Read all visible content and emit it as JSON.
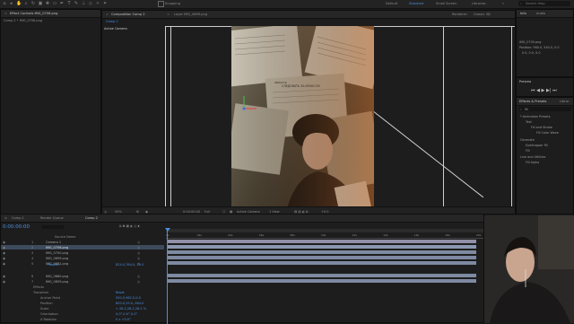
{
  "workspaces": [
    "Default",
    "Standard",
    "Small Screen",
    "Libraries"
  ],
  "toolbar": {
    "snapping_label": "Snapping",
    "search_placeholder": "Search Help"
  },
  "effect_controls": {
    "tab_label": "Effect Controls  IMG_0706.png",
    "breadcrumb": "Comp 2 • IMG_0706.png"
  },
  "viewer": {
    "composition_tab": "Composition  Comp 2",
    "layer_tab": "Layer  IMG_0699.png",
    "comp_breadcrumb": "Comp 2",
    "camera_label": "Active Camera",
    "renderer_label": "Renderer:",
    "renderer_value": "Classic 3D",
    "zoom": "50%",
    "resolution": "Full",
    "view_camera": "Active Camera",
    "view_count": "1 View",
    "exposure": "+0.0",
    "newspaper_headline": "СЛЕДОВАТЬ ЗА ИРАКСОМ",
    "newspaper_subheadline": "ОБЛАСТЬ"
  },
  "info_panel": {
    "tab_info": "Info",
    "tab_audio": "Audio",
    "file": "IMG_0709.png",
    "position": "Position: 960.0, 540.0, 0.0",
    "values": "0.0,  0.0,  0.0"
  },
  "preview_panel": {
    "title": "Preview"
  },
  "effects_presets": {
    "tab_label": "Effects & Presets",
    "tab_library": "Librar",
    "search_value": "fill",
    "items": [
      {
        "label": "* Animation Presets",
        "indent": 0
      },
      {
        "label": "Text",
        "indent": 1
      },
      {
        "label": "Fill and Stroke",
        "indent": 2
      },
      {
        "label": "Fill Color Wave",
        "indent": 3
      },
      {
        "label": "Generate",
        "indent": 0
      },
      {
        "label": "Eyedropper Fill",
        "indent": 1
      },
      {
        "label": "Fill",
        "indent": 1
      },
      {
        "label": "Line and Utilities",
        "indent": 0
      },
      {
        "label": "Fill Alpha",
        "indent": 1
      }
    ]
  },
  "timeline": {
    "tabs": [
      {
        "label": "Comp 1",
        "active": false
      },
      {
        "label": "Render Queue",
        "active": false
      },
      {
        "label": "Comp 2",
        "active": true
      }
    ],
    "timecode": "0:00:00:00",
    "source_name_header": "Source Name",
    "ruler_labels": [
      "0s",
      "02s",
      "04s",
      "06s",
      "08s",
      "10s",
      "12s",
      "14s",
      "16s",
      "18s",
      "20s"
    ],
    "layers": [
      {
        "num": "1",
        "name": "Camera 1",
        "selected": false
      },
      {
        "num": "2",
        "name": "IMG_0706.png",
        "selected": true
      },
      {
        "num": "3",
        "name": "IMG_0700.png",
        "selected": false
      },
      {
        "num": "4",
        "name": "IMG_0699.png",
        "selected": false
      },
      {
        "num": "5",
        "name": "IMG_0661.png",
        "selected": false
      },
      {
        "num": "6",
        "name": "IMG_0660.png",
        "selected": false
      },
      {
        "num": "7",
        "name": "IMG_0659.png",
        "selected": false
      }
    ],
    "position_label": "Position",
    "position_value": "824.0,764.0,-70.0",
    "properties": [
      {
        "label": "Effects",
        "value": ""
      },
      {
        "label": "Transform",
        "value": "Reset"
      },
      {
        "label": "Anchor Point",
        "value": "550.0,962.5,0.0"
      },
      {
        "label": "Position",
        "value": "800.0,29.0,-364.0"
      },
      {
        "label": "Scale",
        "value": "∞ 28.2,28.2,28.2 %"
      },
      {
        "label": "Orientation",
        "value": "0.0°,0.0°,0.0°"
      },
      {
        "label": "X Rotation",
        "value": "0 x +0.0°"
      }
    ]
  },
  "paragraph_panel": {
    "tab_paragraph": "Paragraph",
    "tab_tracker": "Tracker"
  },
  "colors": {
    "accent": "#4a8fe0",
    "timeline_bar": "#7e8aa2",
    "cti": "#4a8fe0"
  }
}
